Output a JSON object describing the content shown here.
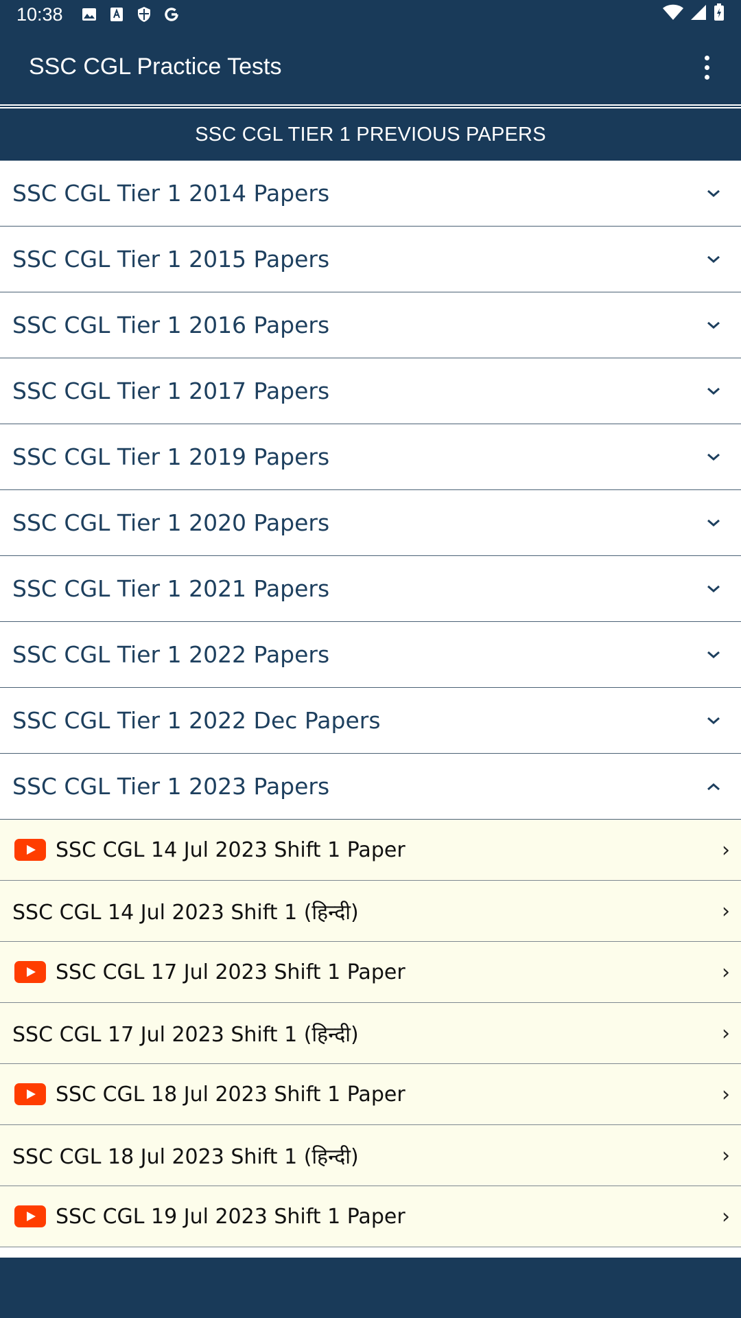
{
  "status_bar": {
    "time": "10:38",
    "icons_left": [
      "image-icon",
      "font-icon",
      "shield-icon",
      "google-icon"
    ],
    "icons_right": [
      "wifi-icon",
      "cell-signal-icon",
      "battery-charging-icon"
    ]
  },
  "app_bar": {
    "title": "SSC CGL Practice Tests",
    "menu_icon": "more-vert-icon"
  },
  "section_header": "SSC CGL TIER 1 PREVIOUS PAPERS",
  "groups": [
    {
      "label": "SSC CGL Tier 1 2014 Papers",
      "expanded": false
    },
    {
      "label": "SSC CGL Tier 1 2015 Papers",
      "expanded": false
    },
    {
      "label": "SSC CGL Tier 1 2016 Papers",
      "expanded": false
    },
    {
      "label": "SSC CGL Tier 1 2017 Papers",
      "expanded": false
    },
    {
      "label": "SSC CGL Tier 1 2019 Papers",
      "expanded": false
    },
    {
      "label": "SSC CGL Tier 1 2020 Papers",
      "expanded": false
    },
    {
      "label": "SSC CGL Tier 1 2021 Papers",
      "expanded": false
    },
    {
      "label": "SSC CGL Tier 1 2022 Papers",
      "expanded": false
    },
    {
      "label": "SSC CGL Tier 1 2022 Dec Papers",
      "expanded": false
    },
    {
      "label": "SSC CGL Tier 1 2023 Papers",
      "expanded": true
    }
  ],
  "items": [
    {
      "label": "SSC CGL 14 Jul 2023 Shift 1 Paper",
      "video": true
    },
    {
      "label": "SSC CGL 14 Jul 2023 Shift 1 (हिन्दी)",
      "video": false
    },
    {
      "label": "SSC CGL 17 Jul 2023 Shift 1 Paper",
      "video": true
    },
    {
      "label": "SSC CGL 17 Jul 2023 Shift 1 (हिन्दी)",
      "video": false
    },
    {
      "label": "SSC CGL 18 Jul 2023 Shift 1 Paper",
      "video": true
    },
    {
      "label": "SSC CGL 18 Jul 2023 Shift 1 (हिन्दी)",
      "video": false
    },
    {
      "label": "SSC CGL 19 Jul 2023 Shift 1 Paper",
      "video": true
    }
  ],
  "colors": {
    "primary": "#193a59",
    "group_text": "#1d3f5e",
    "item_bg": "#fdfdeb",
    "youtube_red": "#ff3d00"
  }
}
